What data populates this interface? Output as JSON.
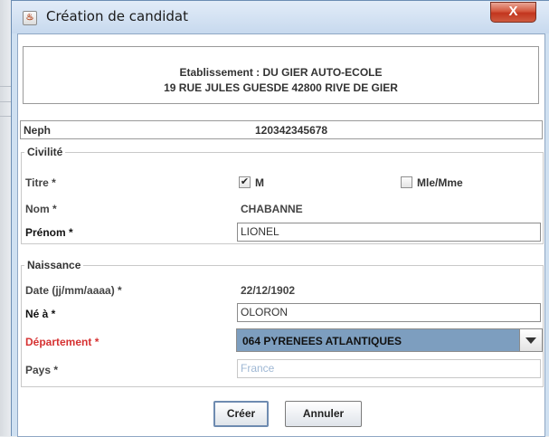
{
  "window": {
    "title": "Création de candidat",
    "icon": "java-cup-icon",
    "close_label": "X"
  },
  "header": {
    "line1": "Etablissement : DU GIER AUTO-ECOLE",
    "line2": "19 RUE JULES GUESDE 42800 RIVE DE GIER"
  },
  "neph": {
    "label": "Neph",
    "value": "120342345678"
  },
  "civilite": {
    "legend": "Civilité",
    "titre": {
      "label": "Titre *",
      "options": [
        {
          "label": "M",
          "checked": true
        },
        {
          "label": "Mle/Mme",
          "checked": false
        }
      ]
    },
    "nom": {
      "label": "Nom *",
      "value": "CHABANNE"
    },
    "prenom": {
      "label": "Prénom *",
      "value": "LIONEL"
    }
  },
  "naissance": {
    "legend": "Naissance",
    "date": {
      "label": "Date (jj/mm/aaaa) *",
      "value": "22/12/1902"
    },
    "ne_a": {
      "label": "Né à *",
      "value": "OLORON"
    },
    "departement": {
      "label": "Département *",
      "value": "064 PYRENEES ATLANTIQUES",
      "label_color": "#d63232"
    },
    "pays": {
      "label": "Pays *",
      "value": "France"
    }
  },
  "buttons": {
    "create": "Créer",
    "cancel": "Annuler"
  },
  "colors": {
    "selection": "#7d9ebf",
    "required_error": "#d63232",
    "close_button": "#c2351e"
  }
}
